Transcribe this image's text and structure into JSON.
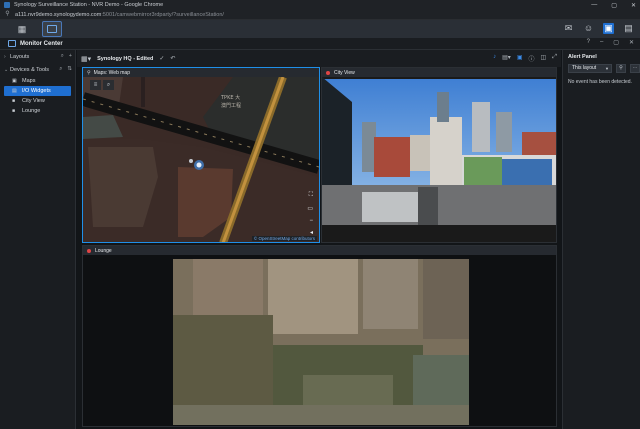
{
  "window": {
    "title": "Synology Surveillance Station - NVR Demo - Google Chrome",
    "controls": [
      "—",
      "▢",
      "✕"
    ]
  },
  "address": {
    "host": "a111.nvr9demo.synologydemo.com",
    "path": ":5001/camwebmirror3rdparty/?surveillanceStation/"
  },
  "appbar": {
    "icons": [
      "message-icon",
      "user-icon",
      "monitor-icon",
      "screen-icon"
    ]
  },
  "monitor_center": {
    "title": "Monitor Center",
    "right_tools": [
      "?",
      "–",
      "▢",
      "✕"
    ]
  },
  "sidebar": {
    "layouts": {
      "label": "Layouts"
    },
    "devices": {
      "label": "Devices & Tools"
    },
    "items": [
      {
        "label": "Maps",
        "icon": "map-icon",
        "selected": false
      },
      {
        "label": "I/O Widgets",
        "icon": "widget-icon",
        "selected": true
      },
      {
        "label": "City View",
        "icon": "camera-icon",
        "selected": false
      },
      {
        "label": "Lounge",
        "icon": "camera-icon",
        "selected": false
      }
    ]
  },
  "toolbar": {
    "layout_name": "Synology HQ - Edited"
  },
  "tiles": {
    "map": {
      "title": "Maps: Web map",
      "attribution": "© OpenStreetMap contributors",
      "labels": [
        "TPKE 大",
        "澳門工程"
      ]
    },
    "city": {
      "title": "City View"
    },
    "lounge": {
      "title": "Lounge"
    }
  },
  "alert_panel": {
    "title": "Alert Panel",
    "filter": "This layout",
    "empty_text": "No event has been detected."
  },
  "colors": {
    "accent": "#1f6fd1",
    "live_dot": "#e04545",
    "active_border": "#1f8fe8"
  }
}
